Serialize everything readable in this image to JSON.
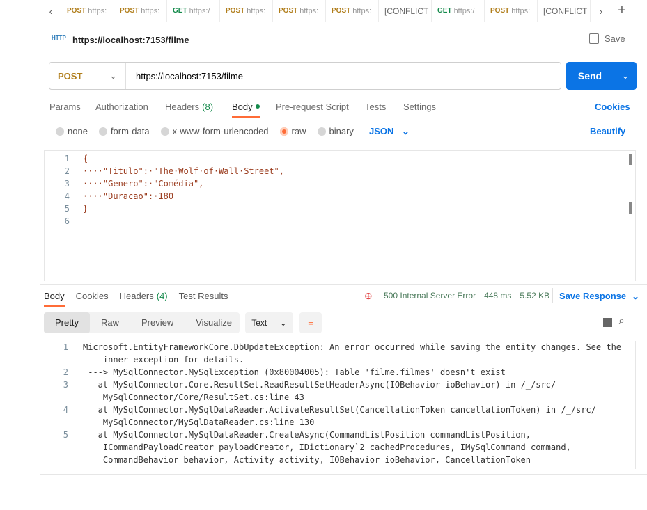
{
  "tabs": [
    {
      "method": "POST",
      "label": "https:"
    },
    {
      "method": "POST",
      "label": "https:"
    },
    {
      "method": "GET",
      "label": "https:/"
    },
    {
      "method": "POST",
      "label": "https:"
    },
    {
      "method": "POST",
      "label": "https:"
    },
    {
      "method": "POST",
      "label": "https:"
    },
    {
      "method": "",
      "label": "[CONFLICT"
    },
    {
      "method": "GET",
      "label": "https:/"
    },
    {
      "method": "POST",
      "label": "https:"
    },
    {
      "method": "",
      "label": "[CONFLICT"
    }
  ],
  "request": {
    "title": "https://localhost:7153/filme",
    "save": "Save",
    "method": "POST",
    "url": "https://localhost:7153/filme",
    "send": "Send"
  },
  "req_tabs": [
    "Params",
    "Authorization",
    "Headers",
    "Body",
    "Pre-request Script",
    "Tests",
    "Settings"
  ],
  "headers_count": "(8)",
  "cookies": "Cookies",
  "body_types": [
    "none",
    "form-data",
    "x-www-form-urlencoded",
    "raw",
    "binary"
  ],
  "body_format": "JSON",
  "beautify": "Beautify",
  "body_lines": [
    "{",
    "····\"Titulo\":·\"The·Wolf·of·Wall·Street\",",
    "····\"Genero\":·\"Comédia\",",
    "····\"Duracao\":·180",
    "}",
    ""
  ],
  "resp_tabs": [
    "Body",
    "Cookies",
    "Headers",
    "Test Results"
  ],
  "resp_headers_count": "(4)",
  "status": {
    "code": "500 Internal Server Error",
    "time": "448 ms",
    "size": "5.52 KB",
    "save_response": "Save Response",
    "color": "#e03a3a"
  },
  "view_tabs": [
    "Pretty",
    "Raw",
    "Preview",
    "Visualize"
  ],
  "view_format": "Text",
  "response_lines": [
    {
      "n": "1",
      "text": [
        "Microsoft.EntityFrameworkCore.DbUpdateException: An error occurred while saving the entity changes. See the",
        "    inner exception for details."
      ]
    },
    {
      "n": "2",
      "text": [
        " ---> MySqlConnector.MySqlException (0x80004005): Table 'filme.filmes' doesn't exist"
      ]
    },
    {
      "n": "3",
      "text": [
        "   at MySqlConnector.Core.ResultSet.ReadResultSetHeaderAsync(IOBehavior ioBehavior) in /_/src/",
        "    MySqlConnector/Core/ResultSet.cs:line 43"
      ]
    },
    {
      "n": "4",
      "text": [
        "   at MySqlConnector.MySqlDataReader.ActivateResultSet(CancellationToken cancellationToken) in /_/src/",
        "    MySqlConnector/MySqlDataReader.cs:line 130"
      ]
    },
    {
      "n": "5",
      "text": [
        "   at MySqlConnector.MySqlDataReader.CreateAsync(CommandListPosition commandListPosition,",
        "    ICommandPayloadCreator payloadCreator, IDictionary`2 cachedProcedures, IMySqlCommand command,",
        "    CommandBehavior behavior, Activity activity, IOBehavior ioBehavior, CancellationToken"
      ]
    }
  ],
  "colors": {
    "accent": "#0b74e5",
    "active_tab": "#ff6c37",
    "get": "#148a4b",
    "post": "#b07d1a"
  }
}
